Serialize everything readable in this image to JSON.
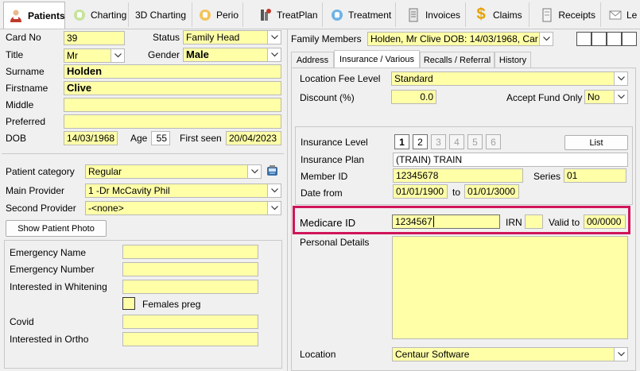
{
  "tabs": [
    {
      "label": "Patients",
      "icon": "patient-icon"
    },
    {
      "label": "Charting",
      "icon": "tooth-chart-icon"
    },
    {
      "label": "3D Charting",
      "icon": "3d-chart-icon"
    },
    {
      "label": "Perio",
      "icon": "perio-tooth-icon"
    },
    {
      "label": "TreatPlan",
      "icon": "treatplan-icon"
    },
    {
      "label": "Treatment",
      "icon": "treatment-tooth-icon"
    },
    {
      "label": "Invoices",
      "icon": "invoice-icon"
    },
    {
      "label": "Claims",
      "icon": "dollar-icon"
    },
    {
      "label": "Receipts",
      "icon": "receipt-icon"
    },
    {
      "label": "Le",
      "icon": "letter-icon"
    }
  ],
  "patient": {
    "card_no_label": "Card No",
    "card_no": "39",
    "status_label": "Status",
    "status": "Family Head",
    "title_label": "Title",
    "title": "Mr",
    "gender_label": "Gender",
    "gender": "Male",
    "surname_label": "Surname",
    "surname": "Holden",
    "firstname_label": "Firstname",
    "firstname": "Clive",
    "middle_label": "Middle",
    "middle": "",
    "preferred_label": "Preferred",
    "preferred": "",
    "dob_label": "DOB",
    "dob": "14/03/1968",
    "age_label": "Age",
    "age": "55",
    "first_seen_label": "First seen",
    "first_seen": "20/04/2023",
    "category_label": "Patient category",
    "category": "Regular",
    "main_provider_label": "Main Provider",
    "main_provider": "1 -Dr McCavity Phil",
    "second_provider_label": "Second Provider",
    "second_provider": "-<none>",
    "show_photo_label": "Show Patient Photo"
  },
  "custom": {
    "emergency_name_label": "Emergency Name",
    "emergency_name": "",
    "emergency_number_label": "Emergency Number",
    "emergency_number": "",
    "whitening_label": "Interested in Whitening",
    "whitening": "",
    "females_preg_label": "Females preg",
    "covid_label": "Covid",
    "covid": "",
    "ortho_label": "Interested in Ortho",
    "ortho": ""
  },
  "family": {
    "label": "Family Members",
    "value": "Holden, Mr Clive DOB: 14/03/1968, Car"
  },
  "subtabs": [
    "Address",
    "Insurance / Various",
    "Recalls / Referral",
    "History"
  ],
  "insurance": {
    "location_fee_label": "Location Fee Level",
    "location_fee": "Standard",
    "discount_label": "Discount (%)",
    "discount": "0.0",
    "accept_fund_label": "Accept Fund Only",
    "accept_fund": "No",
    "level_label": "Insurance Level",
    "levels": [
      "1",
      "2",
      "3",
      "4",
      "5",
      "6"
    ],
    "list_label": "List",
    "plan_label": "Insurance Plan",
    "plan": "(TRAIN) TRAIN",
    "member_label": "Member ID",
    "member": "12345678",
    "series_label": "Series",
    "series": "01",
    "date_from_label": "Date from",
    "date_from": "01/01/1900",
    "to_label": "to",
    "date_to": "01/01/3000",
    "medicare_label": "Medicare ID",
    "medicare": "1234567",
    "irn_label": "IRN",
    "irn": "",
    "valid_to_label": "Valid to",
    "valid_to": "00/0000",
    "personal_label": "Personal Details",
    "personal": "",
    "location_label": "Location",
    "location": "Centaur Software"
  },
  "colors": {
    "field": "#ffffa8",
    "highlight": "#d0145a",
    "panel": "#f0f0f0"
  }
}
